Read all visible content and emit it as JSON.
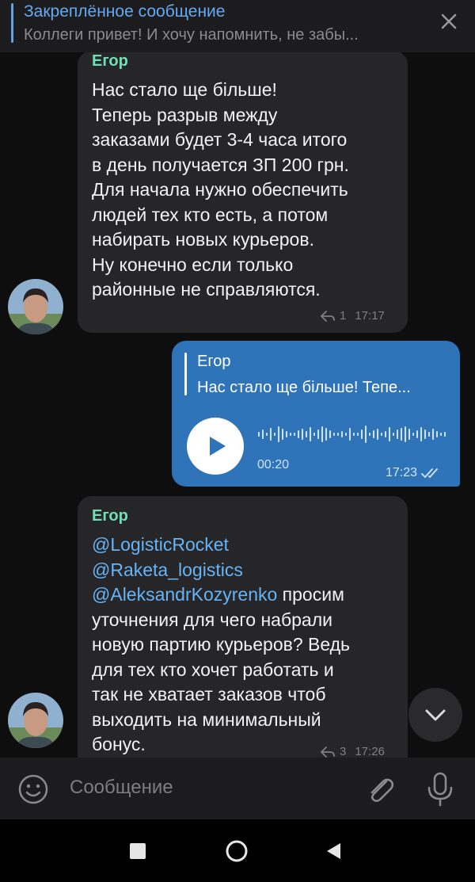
{
  "pinned": {
    "title": "Закреплённое сообщение",
    "text": "Коллеги привет! И хочу напомнить, не забы...",
    "close_icon": "close-icon"
  },
  "messages": [
    {
      "sender": "Егор",
      "lines": [
        "Нас стало ще більше!",
        "Теперь разрыв между",
        "заказами будет 3-4 часа итого",
        "в день получается ЗП 200 грн.",
        "Для начала нужно обеспечить",
        "людей тех кто есть, а потом",
        "набирать новых курьеров.",
        "Ну конечно если только",
        "районные не справляются."
      ],
      "reply_count": "1",
      "time": "17:17"
    },
    {
      "reply_to_name": "Егор",
      "reply_to_text": "Нас стало ще більше! Тепе...",
      "duration": "00:20",
      "time": "17:23",
      "status_icon": "double-check-icon"
    },
    {
      "sender": "Егор",
      "mentions": [
        "@LogisticRocket",
        "@Raketa_logistics",
        "@AleksandrKozyrenko"
      ],
      "after_mention": " просим",
      "lines": [
        "уточнения для чего набрали",
        "новую партию курьеров? Ведь",
        "для тех кто хочет работать и",
        "так не хватает заказов чтоб",
        "выходить на минимальный",
        "бонус."
      ],
      "reply_count": "3",
      "time": "17:26"
    }
  ],
  "composer": {
    "placeholder": "Сообщение"
  },
  "colors": {
    "accent": "#64a9f2",
    "sender": "#6fe0b6",
    "outgoing_bubble": "#2f74b9",
    "incoming_bubble": "#262628"
  }
}
